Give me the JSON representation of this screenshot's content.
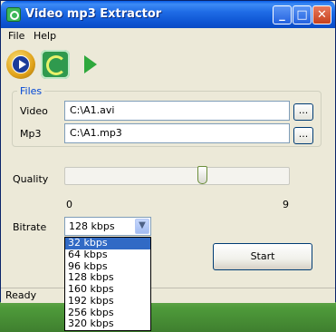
{
  "window": {
    "title": "Video mp3 Extractor"
  },
  "title_buttons": {
    "minimize": "_",
    "maximize": "□",
    "close": "✕"
  },
  "menu": {
    "items": [
      "File",
      "Help"
    ]
  },
  "toolbar": {
    "icons": [
      "play-disc-icon",
      "spiral-icon",
      "play-arrow-icon"
    ]
  },
  "files": {
    "legend": "Files",
    "video_label": "Video",
    "video_value": "C:\\A1.avi",
    "mp3_label": "Mp3",
    "mp3_value": "C:\\A1.mp3",
    "browse_label": "..."
  },
  "quality": {
    "label": "Quality",
    "min_label": "0",
    "max_label": "9",
    "min": 0,
    "max": 9,
    "value": 5.5
  },
  "bitrate": {
    "label": "Bitrate",
    "selected": "128 kbps",
    "options": [
      "32 kbps",
      "64 kbps",
      "96 kbps",
      "128 kbps",
      "160 kbps",
      "192 kbps",
      "256 kbps",
      "320 kbps"
    ],
    "highlighted_index": 0
  },
  "start_button": "Start",
  "status": "Ready"
}
